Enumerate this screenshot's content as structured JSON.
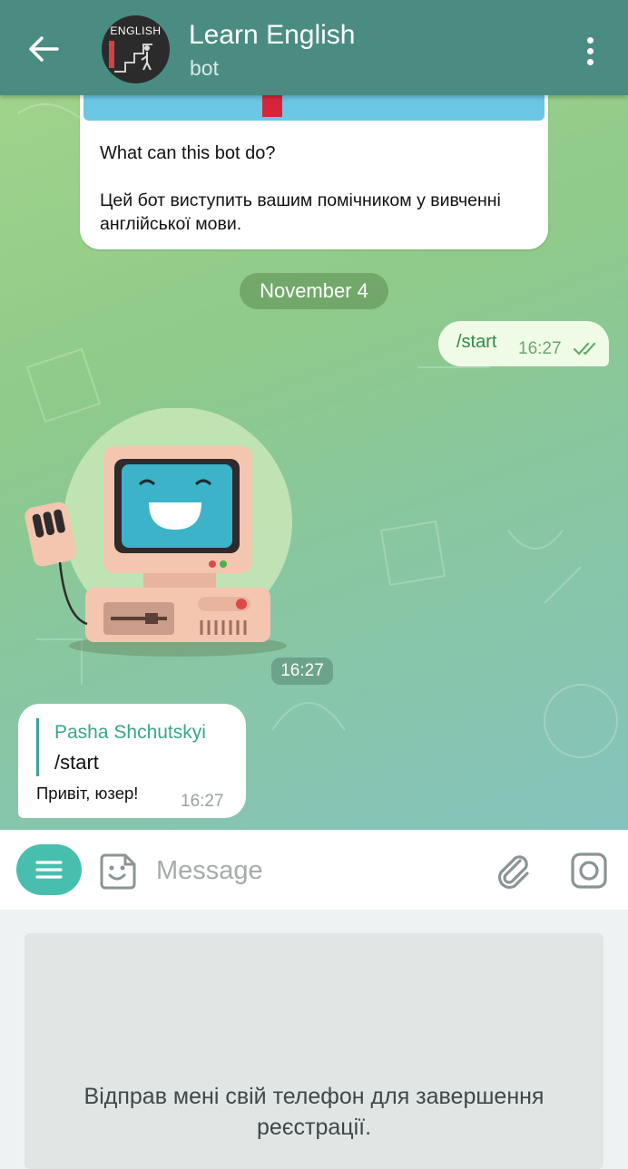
{
  "header": {
    "title": "Learn English",
    "subtitle": "bot",
    "avatar_text": "ENGLISH"
  },
  "intro": {
    "title": "What can this bot do?",
    "text": "Цей бот виступить вашим помічником у вивченні англійської мови."
  },
  "date_separator": "November 4",
  "messages": {
    "outgoing": {
      "text": "/start",
      "time": "16:27"
    },
    "sticker": {
      "time": "16:27"
    },
    "incoming": {
      "reply_name": "Pasha Shchutskyi",
      "reply_text": "/start",
      "text": "Привіт, юзер!",
      "time": "16:27"
    }
  },
  "input": {
    "placeholder": "Message"
  },
  "keyboard": {
    "text": "Відправ мені свій телефон для завершення реєстрації."
  },
  "colors": {
    "header": "#4a8c82",
    "accent": "#48bfae",
    "outgoing_bubble": "#effbe6"
  }
}
